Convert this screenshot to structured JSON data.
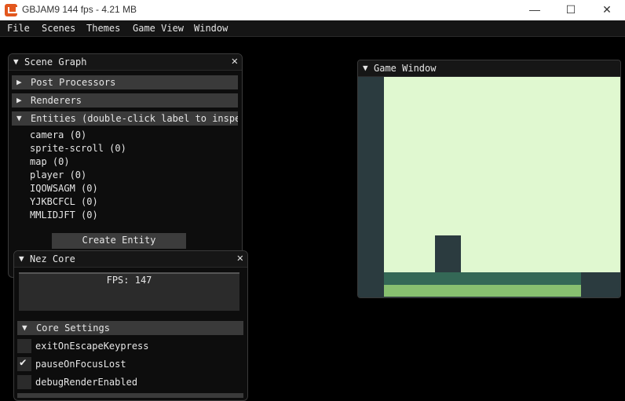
{
  "os_window": {
    "title": "GBJAM9 144 fps - 4.21 MB",
    "icon": "monogame-icon"
  },
  "menu": [
    "File",
    "Scenes",
    "Themes",
    "Game View",
    "Window"
  ],
  "scene_graph": {
    "title": "Scene Graph",
    "sections": [
      {
        "label": "Post Processors",
        "expanded": false
      },
      {
        "label": "Renderers",
        "expanded": false
      },
      {
        "label": "Entities (double-click label to inspect)",
        "expanded": true
      }
    ],
    "entities": [
      "camera (0)",
      "sprite-scroll (0)",
      "map (0)",
      "player (0)",
      "IQOWSAGM (0)",
      "YJKBCFCL (0)",
      "MMLIDJFT (0)"
    ],
    "create_button": "Create Entity"
  },
  "nez_core": {
    "title": "Nez Core",
    "fps_label": "FPS: 147",
    "section": "Core Settings",
    "settings": [
      {
        "label": "exitOnEscapeKeypress",
        "checked": false
      },
      {
        "label": "pauseOnFocusLost",
        "checked": true
      },
      {
        "label": "debugRenderEnabled",
        "checked": false
      }
    ]
  },
  "game_window": {
    "title": "Game Window"
  },
  "colors": {
    "gb_lightest": "#e0f8d0",
    "gb_light": "#88c070",
    "gb_dark": "#346856",
    "gb_darkest": "#2b3b3f"
  }
}
